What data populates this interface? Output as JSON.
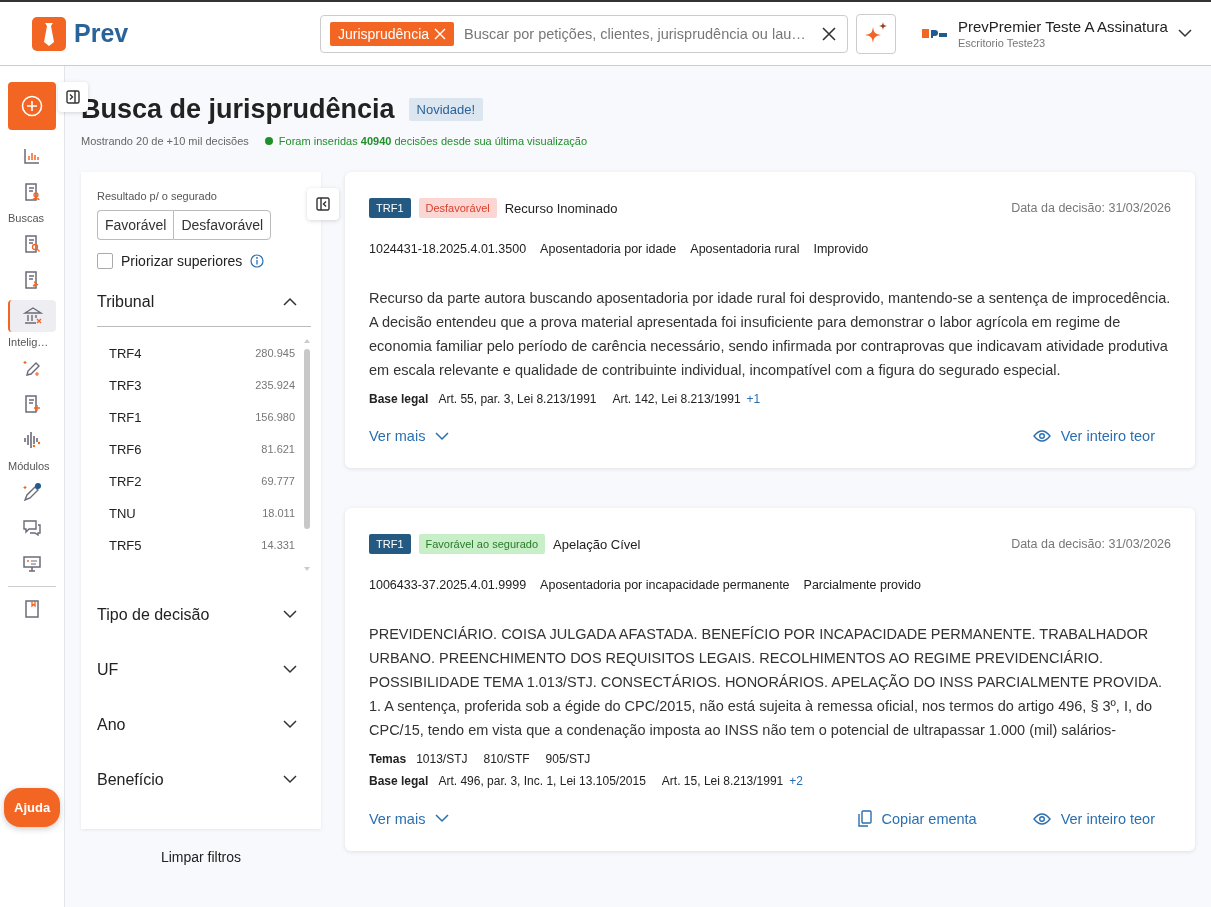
{
  "header": {
    "brand": "Prev",
    "search": {
      "chip": "Jurisprudência",
      "placeholder": "Buscar por petições, clientes, jurisprudência ou lau…"
    },
    "user": {
      "name": "PrevPremier Teste A Assinatura",
      "office": "Escritorio Teste23"
    }
  },
  "rail": [
    {
      "kind": "action"
    },
    {
      "kind": "icon",
      "selected": false
    },
    {
      "kind": "icon",
      "selected": false
    },
    {
      "kind": "label",
      "text": "Buscas"
    },
    {
      "kind": "icon",
      "selected": false
    },
    {
      "kind": "icon",
      "selected": false
    },
    {
      "kind": "icon",
      "selected": true
    },
    {
      "kind": "label",
      "text": "Intelig…"
    },
    {
      "kind": "icon",
      "selected": false
    },
    {
      "kind": "icon",
      "selected": false
    },
    {
      "kind": "icon",
      "selected": false
    },
    {
      "kind": "label",
      "text": "Módulos"
    },
    {
      "kind": "icon",
      "selected": false
    },
    {
      "kind": "icon",
      "selected": false
    },
    {
      "kind": "icon",
      "selected": false
    },
    {
      "kind": "divider"
    },
    {
      "kind": "icon",
      "selected": false
    }
  ],
  "help": "Ajuda",
  "page": {
    "title": "Busca de jurisprudência",
    "badge": "Novidade!",
    "count": "Mostrando 20 de +10 mil decisões",
    "notice": "Foram inseridas **40940** decisões desde sua última visualização"
  },
  "filters": {
    "result_label": "Resultado p/ o segurado",
    "result_options": [
      {
        "label": "Favorável",
        "selected": false
      },
      {
        "label": "Desfavorável",
        "selected": false
      }
    ],
    "prioritize": {
      "label": "Priorizar superiores",
      "checked": false
    },
    "sections": [
      {
        "title": "Tribunal",
        "expanded": true,
        "items": [
          {
            "name": "TRF4",
            "count": "280.945"
          },
          {
            "name": "TRF3",
            "count": "235.924"
          },
          {
            "name": "TRF1",
            "count": "156.980"
          },
          {
            "name": "TRF6",
            "count": "81.621"
          },
          {
            "name": "TRF2",
            "count": "69.777"
          },
          {
            "name": "TNU",
            "count": "18.011"
          },
          {
            "name": "TRF5",
            "count": "14.331"
          }
        ]
      },
      {
        "title": "Tipo de decisão",
        "expanded": false
      },
      {
        "title": "UF",
        "expanded": false
      },
      {
        "title": "Ano",
        "expanded": false
      },
      {
        "title": "Benefício",
        "expanded": false
      }
    ],
    "clear": "Limpar filtros"
  },
  "results": [
    {
      "court": "TRF1",
      "outcome": {
        "text": "Desfavorável",
        "kind": "unfavorable"
      },
      "type": "Recurso Inominado",
      "date": "Data da decisão: 31/03/2026",
      "meta": [
        "1024431-18.2025.4.01.3500",
        "Aposentadoria por idade",
        "Aposentadoria rural",
        "Improvido"
      ],
      "body": [
        "Recurso da parte autora buscando aposentadoria por idade rural foi desprovido, mantendo-se a sentença de improcedência. A decisão entendeu que a prova material apresentada foi insuficiente para demonstrar o labor agrícola em regime de economia familiar pelo período de carência necessário, sendo infirmada por contraprovas que indicavam atividade produtiva em escala relevante e qualidade de contribuinte individual, incompatível com a figura do segurado especial."
      ],
      "refs": [
        {
          "label": "Base legal",
          "items": [
            "Art. 55, par. 3, Lei 8.213/1991",
            "Art. 142, Lei 8.213/1991"
          ],
          "more": "+1"
        }
      ],
      "more": "Ver mais",
      "actions": [
        {
          "kind": "view",
          "text": "Ver inteiro teor"
        }
      ]
    },
    {
      "court": "TRF1",
      "outcome": {
        "text": "Favorável ao segurado",
        "kind": "favorable"
      },
      "type": "Apelação Cível",
      "date": "Data da decisão: 31/03/2026",
      "meta": [
        "1006433-37.2025.4.01.9999",
        "Aposentadoria por incapacidade permanente",
        "Parcialmente provido"
      ],
      "body": [
        "PREVIDENCIÁRIO. COISA JULGADA AFASTADA. BENEFÍCIO POR INCAPACIDADE PERMANENTE. TRABALHADOR URBANO. PREENCHIMENTO DOS REQUISITOS LEGAIS. RECOLHIMENTOS AO REGIME PREVIDENCIÁRIO. POSSIBILIDADE TEMA 1.013/STJ. CONSECTÁRIOS. HONORÁRIOS. APELAÇÃO DO INSS PARCIALMENTE PROVIDA.",
        "1. A sentença, proferida sob a égide do CPC/2015, não está sujeita à remessa oficial, nos termos do artigo 496, § 3º, I, do CPC/15, tendo em vista que a condenação imposta ao INSS não tem o potencial de ultrapassar 1.000 (mil) salários-"
      ],
      "refs": [
        {
          "label": "Temas",
          "items": [
            "1013/STJ",
            "810/STF",
            "905/STJ"
          ]
        },
        {
          "label": "Base legal",
          "items": [
            "Art. 496, par. 3, Inc. 1, Lei 13.105/2015",
            "Art. 15, Lei 8.213/1991"
          ],
          "more": "+2"
        }
      ],
      "more": "Ver mais",
      "actions": [
        {
          "kind": "copy",
          "text": "Copiar ementa"
        },
        {
          "kind": "view",
          "text": "Ver inteiro teor"
        }
      ]
    }
  ]
}
